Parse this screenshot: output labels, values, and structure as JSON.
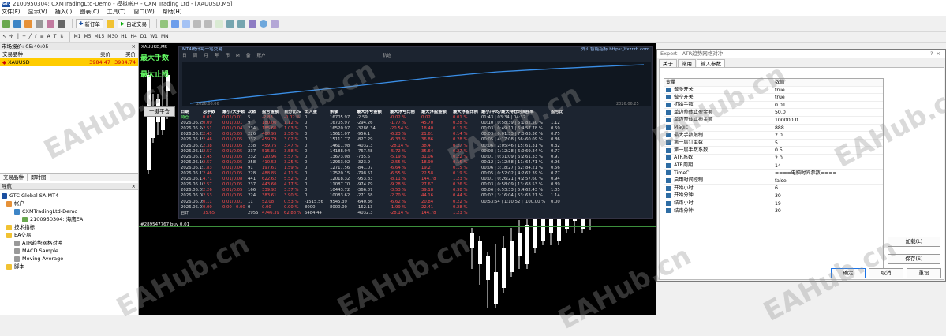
{
  "window": {
    "title": "2100950304: CXMTradingLtd-Demo - 模拟帐户 - CXM Trading Ltd - [XAUUSD,M5]",
    "logo": "GTC"
  },
  "menu": [
    "文件(F)",
    "显示(V)",
    "插入(I)",
    "图表(C)",
    "工具(T)",
    "窗口(W)",
    "帮助(H)"
  ],
  "toolbar": {
    "new_order": "新订单",
    "auto_trade": "自动交易",
    "timeframes": [
      "M1",
      "M5",
      "M15",
      "M30",
      "H1",
      "H4",
      "D1",
      "W1",
      "MN"
    ]
  },
  "market_watch": {
    "title": "市场报价: 05:40:05",
    "columns": [
      "交易品种",
      "卖价",
      "买价"
    ],
    "rows": [
      {
        "symbol": "XAUUSD",
        "bid": "3984.47",
        "ask": "3984.74"
      }
    ]
  },
  "bottom_tabs": [
    "交易品种",
    "即时图"
  ],
  "navigator": {
    "title": "导航",
    "items": [
      "GTC Global SA MT4",
      "帐户",
      "CXMTradingLtd-Demo",
      "2100950304: 海鹰EA",
      "技术指标",
      "EA交易",
      "ATR趋势网格对冲",
      "MACD Sample",
      "Moving Average",
      "脚本"
    ]
  },
  "chart": {
    "tab": "XAUUSD,M5",
    "stats_title": "MT4统计每一笔交易",
    "stats_brand": "外汇智能指标 https://fxzrzb.com",
    "stats_tabs": [
      "日",
      "周",
      "月",
      "年",
      "币",
      "M",
      "备",
      "账户",
      "轨迹"
    ],
    "curve_start_label": "2026.06.06",
    "curve_end_label": "2026.06.25",
    "overlay_text_1": "最大手数",
    "overlay_text_2": "最大止损",
    "overlay_button": "一键平仓",
    "order_line": "#289547767 buy 0.01"
  },
  "stats_table": {
    "headers": [
      "日期",
      "总手数",
      "最小/大手数",
      "次数",
      "盈亏金额",
      "百分比%",
      "出入金",
      "余额",
      "最大浮亏金额",
      "最大浮亏比例",
      "最大浮盈金额",
      "最大浮盈比例",
      "最小/平均/最大持仓时间",
      "胜率",
      "盈亏比"
    ],
    "rows": [
      [
        "持仓",
        "0.05",
        "0.01/0.01",
        "5",
        "-2.88",
        "-0.02 %",
        "0",
        "16705.97",
        "-2.59",
        "-0.02 %",
        "0.02",
        "0.01 %",
        "01:43 | 03:34 | 04:32",
        "",
        ""
      ],
      [
        "2026.06.25",
        "0.09",
        "0.01/0.01",
        "9",
        "180.00",
        "1.12 %",
        "0",
        "16705.97",
        "-294.26",
        "-1.77 %",
        "45.70",
        "0.28 %",
        "00:10 | 0:58:39 | 5:15:18",
        "82.50 %",
        "1.12"
      ],
      [
        "2026.06.24",
        "2.51",
        "0.01/0.04",
        "234",
        "185.60",
        "1.03 %",
        "0",
        "16520.97",
        "-3286.34",
        "-20.54 %",
        "18.40",
        "0.11 %",
        "00:03 | 0:49:11 | 6:41:55",
        "57.78 %",
        "0.59"
      ],
      [
        "2026.06.23",
        "2.43",
        "0.01/0.05",
        "226",
        "400.95",
        "2.50 %",
        "0",
        "15611.07",
        "-956.1",
        "-6.23 %",
        "21.61",
        "0.14 %",
        "00:03 | 0:01:33 | 7:05:21",
        "63.36 %",
        "0.75"
      ],
      [
        "2026.06.19",
        "2.46",
        "0.01/0.05",
        "232",
        "459.79",
        "3.02 %",
        "0",
        "15111.77",
        "-827.29",
        "-6.33 %",
        "36.86",
        "0.28 %",
        "00:05 | 4:17:08 | 56:45:29",
        "60.09 %",
        "0.86"
      ],
      [
        "2026.06.22",
        "2.38",
        "0.01/0.05",
        "238",
        "459.75",
        "3.47 %",
        "0",
        "14611.98",
        "-4032.3",
        "-28.14 %",
        "38.4",
        "0.27 %",
        "00:06 | 2:05:46 | 15:51:17",
        "61.31 %",
        "0.32"
      ],
      [
        "2026.06.18",
        "2.57",
        "0.01/0.05",
        "237",
        "515.81",
        "3.58 %",
        "0",
        "14188.94",
        "-767.48",
        "-5.72 %",
        "35.64",
        "0.27 %",
        "00:08 | 1:12:28 | 6:06:00",
        "69.34 %",
        "0.77"
      ],
      [
        "2026.06.17",
        "2.45",
        "0.01/0.05",
        "232",
        "720.96",
        "5.57 %",
        "0",
        "13673.08",
        "-735.5",
        "-5.19 %",
        "31.06",
        "0.22 %",
        "00:01 | 0:31:09 | 6:22:37",
        "61.33 %",
        "0.97"
      ],
      [
        "2026.06.16",
        "2.57",
        "0.01/0.05",
        "258",
        "410.52",
        "3.25 %",
        "0",
        "12963.02",
        "-323.9",
        "-2.55 %",
        "18.90",
        "0.15 %",
        "00:12 | 2:12:58 | 11:18:31",
        "64.71 %",
        "0.96"
      ],
      [
        "2026.06.15",
        "1.83",
        "0.01/0.04",
        "91",
        "197.61",
        "1.59 %",
        "0",
        "12717.56",
        "-841.07",
        "-6.64 %",
        "19.2",
        "0.15 %",
        "00:06 | 3:18:27 | 62:15:05",
        "84.21 %",
        "0.56"
      ],
      [
        "2026.06.12",
        "2.46",
        "0.01/0.05",
        "228",
        "488.85",
        "4.11 %",
        "0",
        "12520.15",
        "-798.51",
        "-6.55 %",
        "22.58",
        "0.19 %",
        "00:05 | 0:52:02 | 4:23:31",
        "62.39 %",
        "0.77"
      ],
      [
        "2026.06.11",
        "4.71",
        "0.01/0.08",
        "441",
        "622.62",
        "5.52 %",
        "0",
        "12018.32",
        "-953.83",
        "-8.11 %",
        "144.78",
        "1.23 %",
        "00:01 | 0:26:21 | 4:21:14",
        "57.60 %",
        "0.94"
      ],
      [
        "2026.06.10",
        "2.57",
        "0.01/0.05",
        "237",
        "443.60",
        "4.17 %",
        "0",
        "11087.70",
        "-974.79",
        "-9.28 %",
        "27.67",
        "0.26 %",
        "00:03 | 0:58:09 | 13:13:21",
        "68.53 %",
        "0.89"
      ],
      [
        "2026.06.09",
        "2.26",
        "0.01/0.05",
        "166",
        "339.92",
        "3.37 %",
        "0",
        "10443.72",
        "-366.07",
        "-3.53 %",
        "39.18",
        "0.38 %",
        "00:06 | 0:53:33 | 5:42:04",
        "62.43 %",
        "1.05"
      ],
      [
        "2026.06.08",
        "2.53",
        "0.01/0.05",
        "224",
        "383.61",
        "3.90 %",
        "0",
        "10083.62",
        "-271.68",
        "-2.70 %",
        "44.16",
        "0.44 %",
        "00:02 | 3:16:04 | 53:32:18",
        "63.21 %",
        "1.14"
      ],
      [
        "2026.06.05",
        "0.11",
        "0.01/0.01",
        "11",
        "52.08",
        "0.53 %",
        "-1515.56",
        "9545.39",
        "-640.36",
        "-6.62 %",
        "20.84",
        "0.22 %",
        "00:53:54 | 1:10:52 | 1:20:33",
        "100.00 %",
        "0.00"
      ],
      [
        "2026.06.01",
        "0.00",
        "0.00 | 0.00",
        "0",
        "0.00",
        "0.00 %",
        "8000",
        "8000.00",
        "-162.13",
        "-1.99 %",
        "22.41",
        "0.28 %",
        "",
        "",
        ""
      ],
      [
        "合计",
        "35.65",
        "",
        "2955",
        "4746.39",
        "62.88 %",
        "6484.44",
        "",
        "-4032.3",
        "-28.14 %",
        "144.78",
        "1.23 %",
        "",
        "",
        ""
      ]
    ]
  },
  "dialog": {
    "title": "Expert - ATR趋势网格对冲",
    "question": "?",
    "close": "×",
    "tabs": [
      "关于",
      "常用",
      "输入参数"
    ],
    "col_var": "变量",
    "col_val": "数值",
    "params": [
      [
        "做多开关",
        "true"
      ],
      [
        "做空开关",
        "true"
      ],
      [
        "初始手数",
        "0.01"
      ],
      [
        "单边整体止盈金额",
        "50.0"
      ],
      [
        "单边整体止损金额",
        "100000.0"
      ],
      [
        "Magic",
        "888"
      ],
      [
        "最大手数限制",
        "2.0"
      ],
      [
        "第一层订单数",
        "5"
      ],
      [
        "第一层手数系数",
        "0.5"
      ],
      [
        "ATR系数",
        "2.0"
      ],
      [
        "ATR周期",
        "14"
      ],
      [
        "TimeC",
        "====电脑时间参数===="
      ],
      [
        "启用时间控制",
        "false"
      ],
      [
        "开始小时",
        "6"
      ],
      [
        "开始分钟",
        "30"
      ],
      [
        "结束小时",
        "19"
      ],
      [
        "结束分钟",
        "30"
      ]
    ],
    "load_button": "加载(L)",
    "save_button": "保存(S)",
    "ok_button": "确定",
    "cancel_button": "取消",
    "reset_button": "重设"
  },
  "watermark": "EAHub.cn",
  "colors": {
    "accent": "#1a4fa0",
    "selected_row": "#ffcc00",
    "profit": "#33ff33",
    "loss": "#ff4d4d",
    "candle_up": "#ffffff",
    "candle_down": "#00c000"
  }
}
